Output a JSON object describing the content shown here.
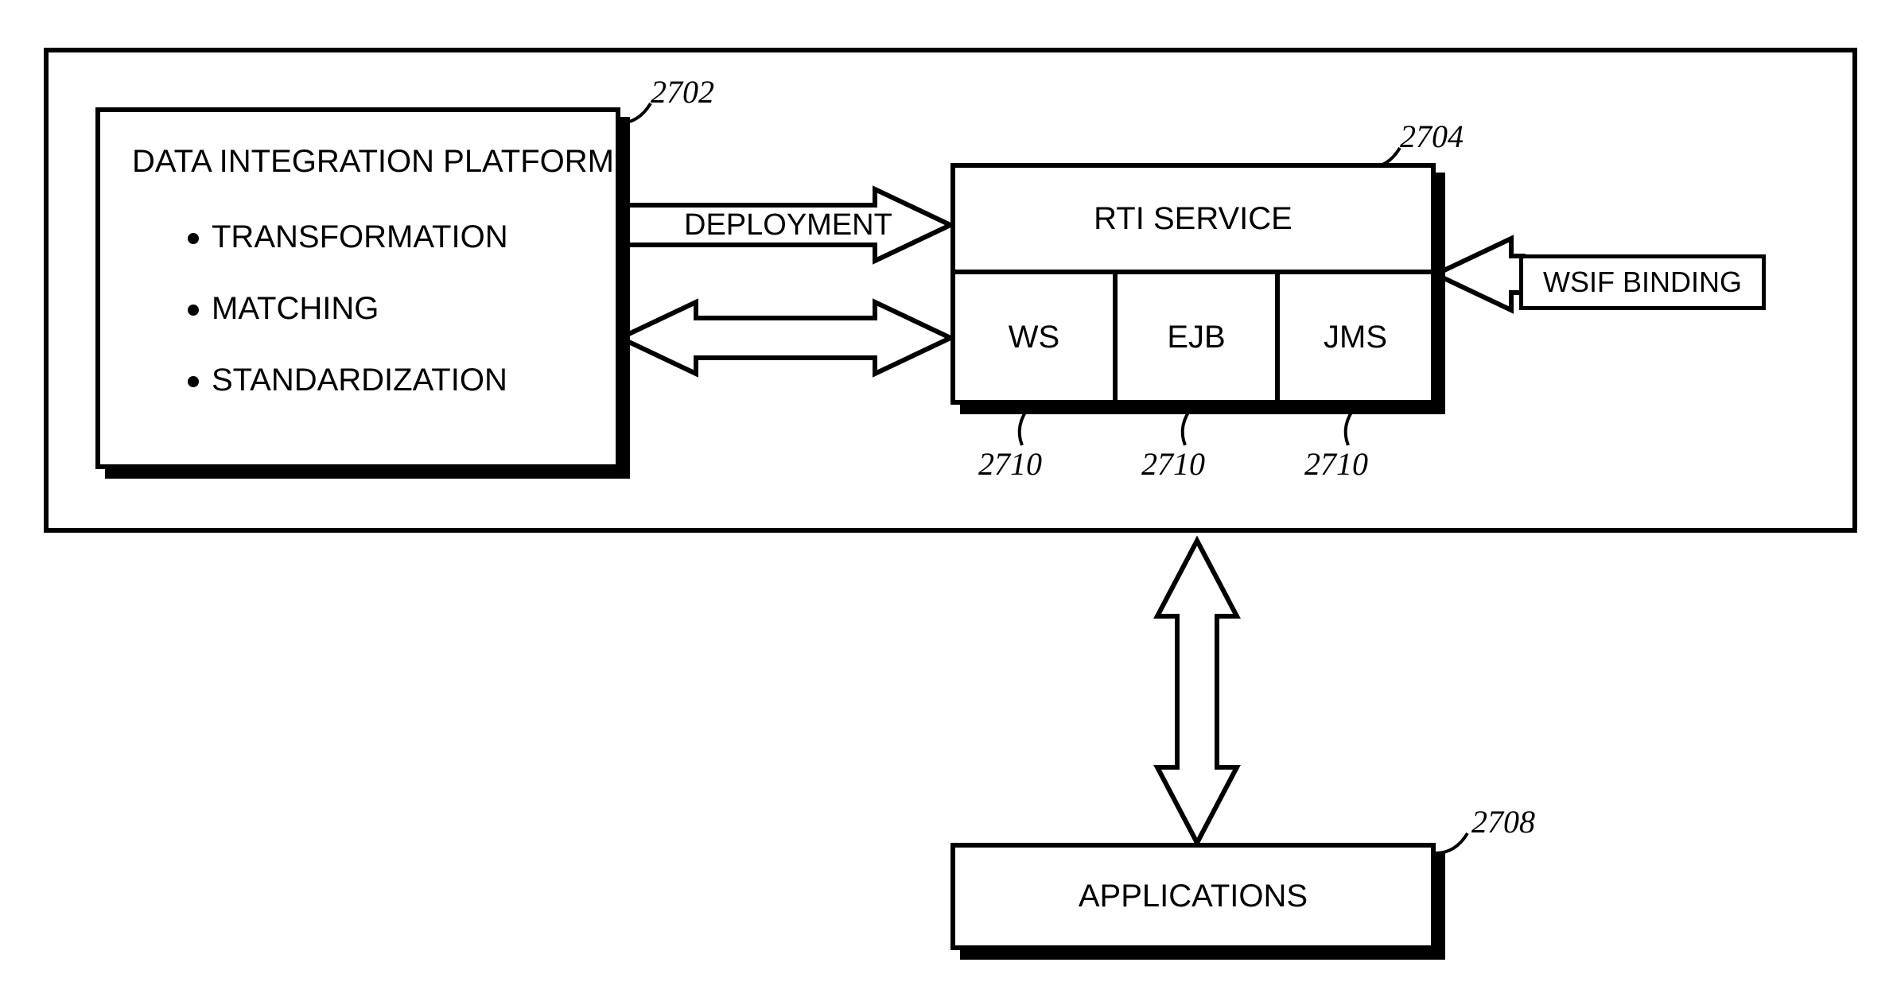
{
  "outer": {
    "platform_title": "DATA INTEGRATION PLATFORM",
    "bullets": [
      "TRANSFORMATION",
      "MATCHING",
      "STANDARDIZATION"
    ],
    "deployment_label": "DEPLOYMENT",
    "rti_title": "RTI SERVICE",
    "protocols": {
      "ws": "WS",
      "ejb": "EJB",
      "jms": "JMS"
    },
    "wsif_label": "WSIF BINDING",
    "applications_label": "APPLICATIONS"
  },
  "refs": {
    "platform": "2702",
    "rti": "2704",
    "ws": "2710",
    "ejb": "2710",
    "jms": "2710",
    "applications": "2708"
  }
}
